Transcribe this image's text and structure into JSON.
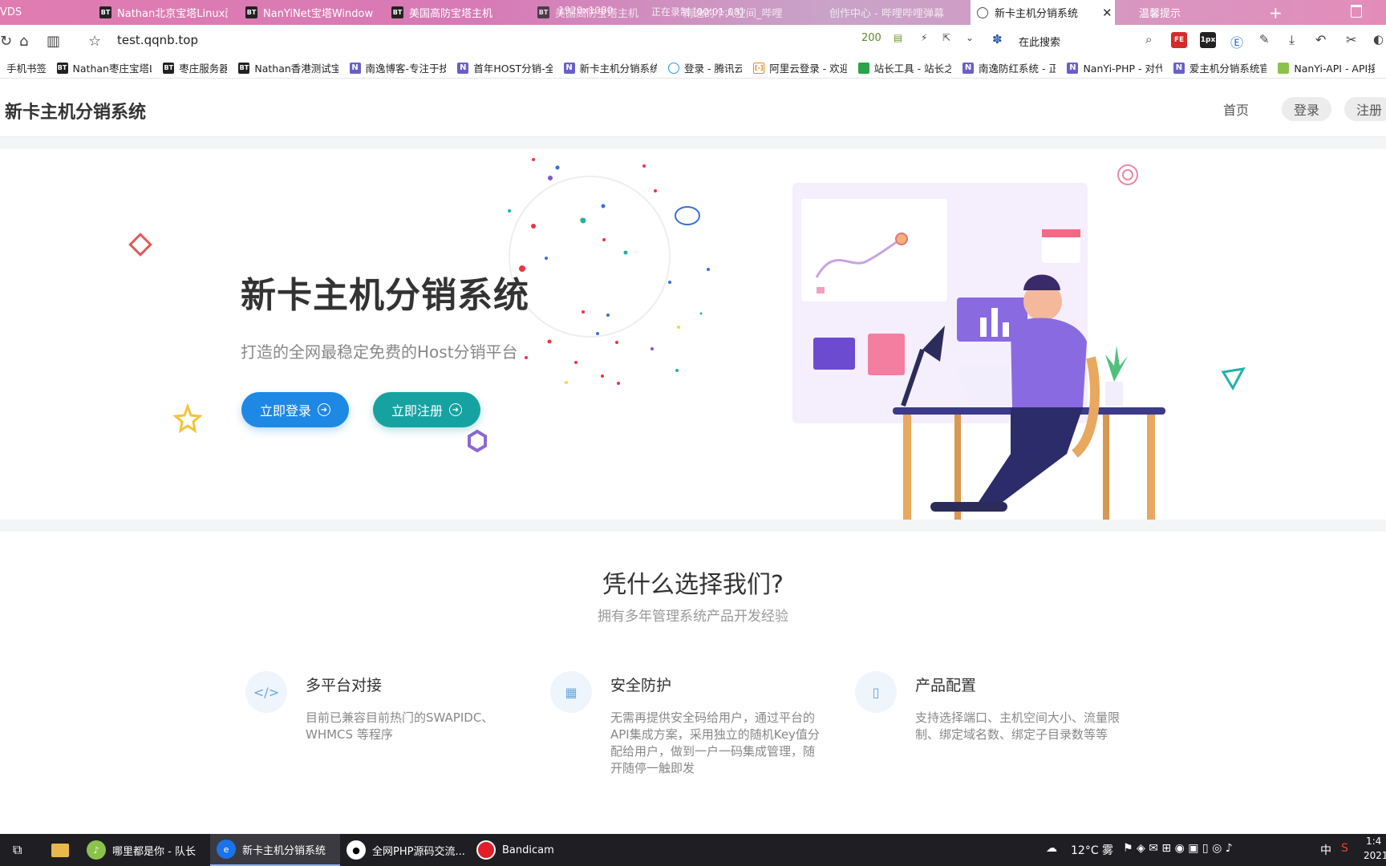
{
  "browser": {
    "tabs": [
      {
        "label": "VDS"
      },
      {
        "label": "Nathan北京宝塔Linux面板"
      },
      {
        "label": "NanYiNet宝塔Windows面板"
      },
      {
        "label": "美国高防宝塔主机"
      },
      {
        "label": "美国高防宝塔主机"
      },
      {
        "label": "南逸的个人空间_哔哩"
      },
      {
        "label": "创作中心 - 哔哩哔哩弹幕"
      },
      {
        "label": "新卡主机分销系统",
        "active": true
      },
      {
        "label": "温馨提示"
      }
    ],
    "recording_overlay": {
      "resolution": "1920x1080",
      "status": "正在录制 [00:01:08]"
    },
    "url": "test.qqnb.top",
    "status_code": "200",
    "search_placeholder": "在此搜索",
    "extensions": [
      "FE",
      "1px"
    ],
    "bookmarks": [
      {
        "label": "手机书签",
        "icon": "none"
      },
      {
        "label": "Nathan枣庄宝塔L",
        "icon": "bt"
      },
      {
        "label": "枣庄服务器",
        "icon": "bt"
      },
      {
        "label": "Nathan香港测试宝",
        "icon": "bt"
      },
      {
        "label": "南逸博客-专注于技",
        "icon": "n"
      },
      {
        "label": "首年HOST分销-全",
        "icon": "n"
      },
      {
        "label": "新卡主机分销系统",
        "icon": "n"
      },
      {
        "label": "登录 - 腾讯云",
        "icon": "cloud"
      },
      {
        "label": "阿里云登录 - 欢迎",
        "icon": "ali"
      },
      {
        "label": "站长工具 - 站长之",
        "icon": "tool"
      },
      {
        "label": "南逸防红系统 - 正",
        "icon": "n"
      },
      {
        "label": "NanYi-PHP - 对代",
        "icon": "n"
      },
      {
        "label": "爱主机分销系统官",
        "icon": "n"
      },
      {
        "label": "NanYi-API - API接",
        "icon": "leaf"
      }
    ]
  },
  "site": {
    "brand": "新卡主机分销系统",
    "nav": {
      "home": "首页",
      "login": "登录",
      "register": "注册"
    },
    "hero": {
      "title": "新卡主机分销系统",
      "subtitle": "打造的全网最稳定免费的Host分销平台",
      "login_button": "立即登录",
      "register_button": "立即注册"
    },
    "features_section": {
      "title": "凭什么选择我们?",
      "subtitle": "拥有多年管理系统产品开发经验",
      "items": [
        {
          "icon": "code-icon",
          "title": "多平台对接",
          "desc": "目前已兼容目前热门的SWAPIDC、WHMCS 等程序"
        },
        {
          "icon": "grid-icon",
          "title": "安全防护",
          "desc": "无需再提供安全码给用户，通过平台的API集成方案，采用独立的随机Key值分配给用户，做到一户一码集成管理，随开随停一触即发"
        },
        {
          "icon": "tablet-icon",
          "title": "产品配置",
          "desc": "支持选择端口、主机空间大小、流量限制、绑定域名数、绑定子目录数等等"
        }
      ]
    }
  },
  "taskbar": {
    "items": [
      {
        "label": "哪里都是你 - 队长"
      },
      {
        "label": "新卡主机分销系统",
        "active": true
      },
      {
        "label": "全网PHP源码交流..."
      },
      {
        "label": "Bandicam"
      }
    ],
    "weather": "12°C 雾",
    "ime": "中",
    "time": "1:4",
    "date": "2021"
  },
  "colors": {
    "login_button": "#1e88e5",
    "register_button": "#17a2a2",
    "feature_icon": "#6aa7dd"
  }
}
